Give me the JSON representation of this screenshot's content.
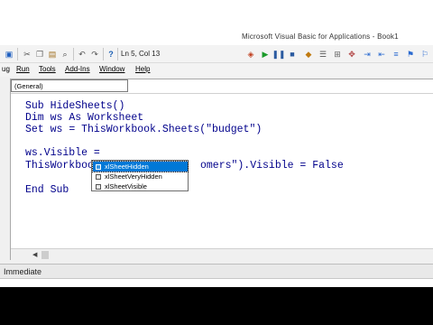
{
  "window": {
    "title_fragment": "Microsoft Visual Basic for Applications - Book1"
  },
  "toolbar": {
    "position": "Ln 5, Col 13",
    "icons": [
      "save-icon",
      "cut-icon",
      "copy-icon",
      "paste-icon",
      "find-icon",
      "undo-icon",
      "redo-icon",
      "run-icon",
      "break-icon",
      "reset-icon",
      "design-mode-icon",
      "project-explorer-icon",
      "properties-icon",
      "object-browser-icon",
      "toolbox-icon",
      "help-icon"
    ]
  },
  "menu": {
    "debug": "ug",
    "run": "Run",
    "tools": "Tools",
    "addins": "Add-Ins",
    "window": "Window",
    "help": "Help"
  },
  "code_window": {
    "object_combo": "(General)",
    "lines": {
      "l1_kw": "Sub",
      "l1_rest": " HideSheets()",
      "l2_kw": "Dim",
      "l2_mid": " ws ",
      "l2_kw2": "As",
      "l2_rest": " Worksheet",
      "l3_kw": "Set",
      "l3_rest": " ws = ThisWorkbook.Sheets(\"budget\")",
      "l4": "ws.Visible =",
      "l5_left": "ThisWorkboo",
      "l5_right": "omers\").Visible = False",
      "l6": "End Sub"
    }
  },
  "autocomplete": {
    "items": [
      "xlSheetHidden",
      "xlSheetVeryHidden",
      "xlSheetVisible"
    ],
    "selected_index": 0
  },
  "immediate": {
    "title": "Immediate"
  }
}
